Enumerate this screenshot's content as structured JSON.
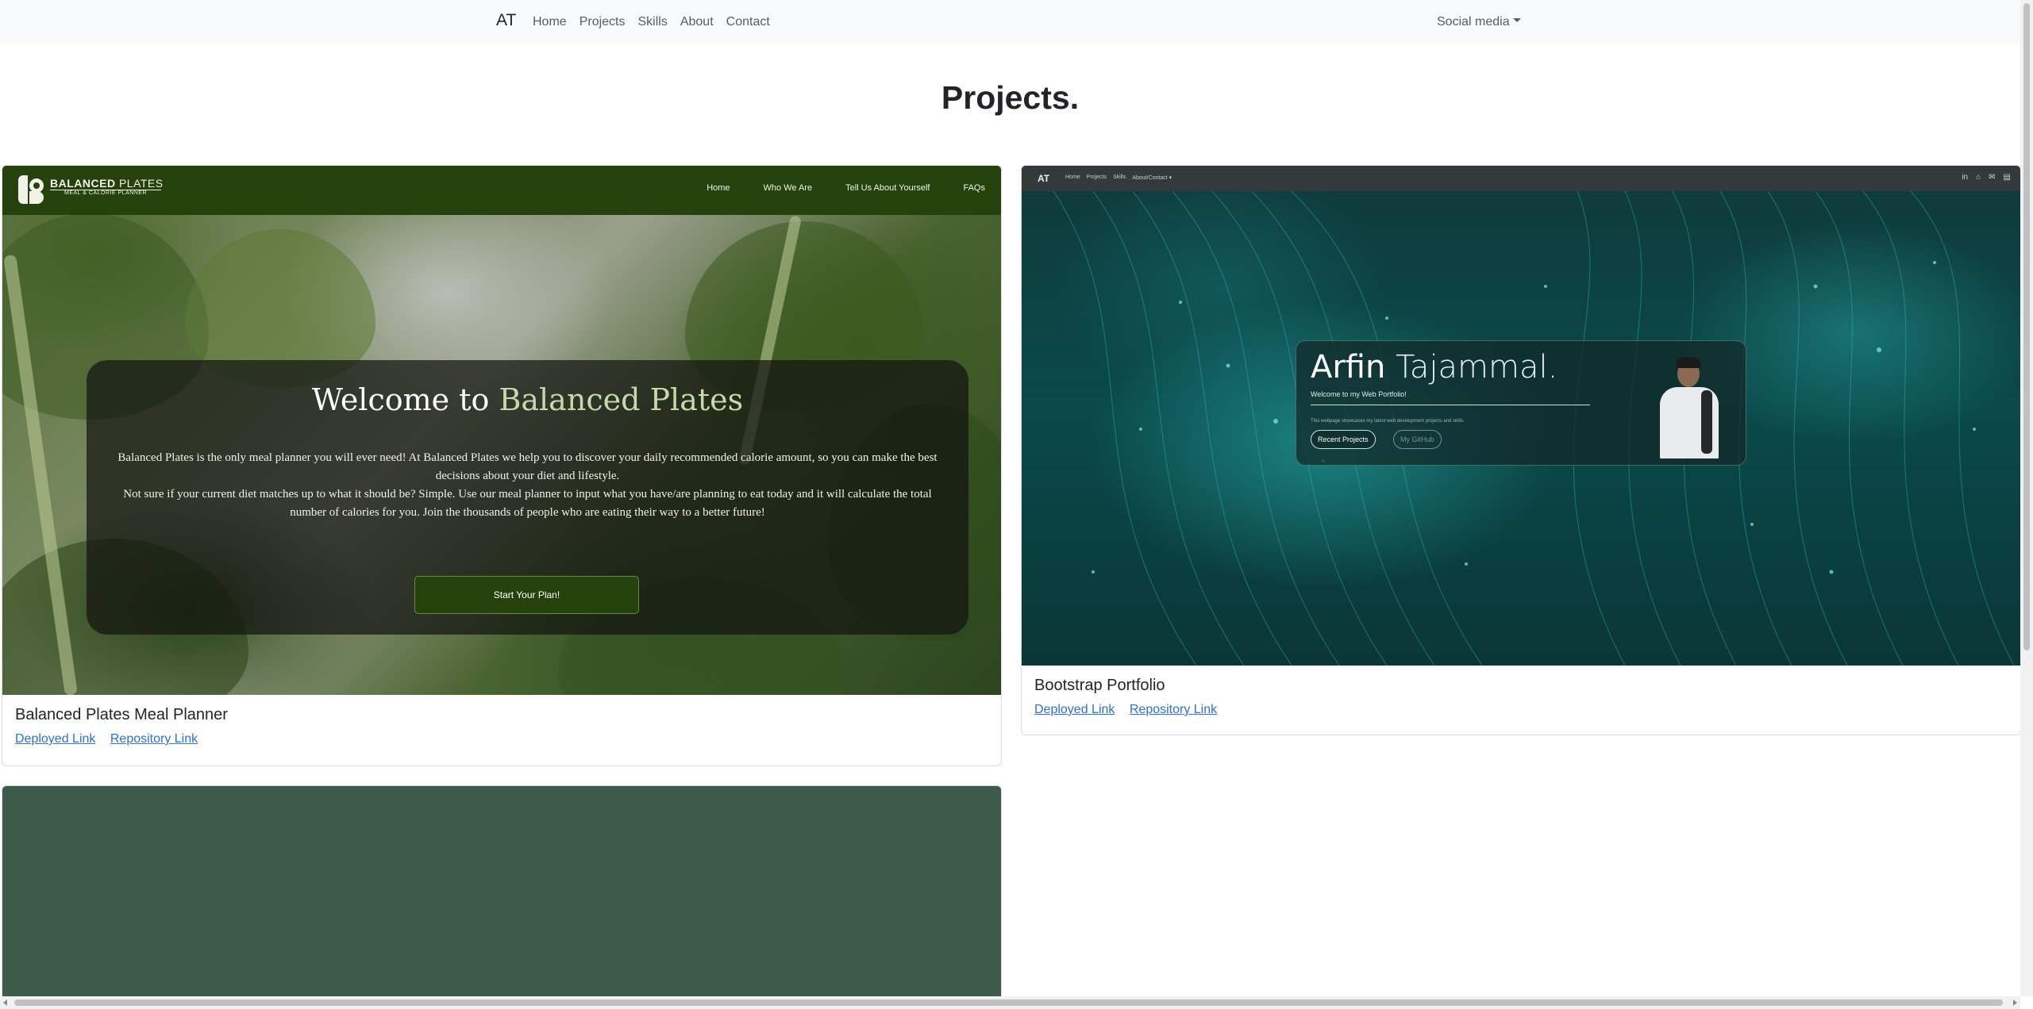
{
  "navbar": {
    "brand": "AT",
    "links": [
      "Home",
      "Projects",
      "Skills",
      "About",
      "Contact"
    ],
    "social_label": "Social media"
  },
  "page_title": "Projects.",
  "projects": [
    {
      "title": "Balanced Plates Meal Planner",
      "deployed_label": "Deployed Link",
      "repo_label": "Repository Link",
      "screenshot": {
        "logo_text_bold": "BALANCED",
        "logo_text_thin": " PLATES",
        "logo_sub": "MEAL & CALORIE PLANNER",
        "menu": [
          "Home",
          "Who We Are",
          "Tell Us About Yourself",
          "FAQs"
        ],
        "heading_plain": "Welcome to ",
        "heading_accent": "Balanced Plates",
        "paragraph_1": "Balanced Plates is the only meal planner you will ever need! At Balanced Plates we help you to discover your daily recommended calorie amount, so you can make the best decisions about your diet and lifestyle.",
        "paragraph_2": "Not sure if your current diet matches up to what it should be? Simple. Use our meal planner to input what you have/are planning to eat today and it will calculate the total number of calories for you. Join the thousands of people who are eating their way to a better future!",
        "button": "Start Your Plan!"
      }
    },
    {
      "title": "Bootstrap Portfolio",
      "deployed_label": "Deployed Link",
      "repo_label": "Repository Link",
      "screenshot": {
        "brand": "AT",
        "menu": [
          "Home",
          "Projects",
          "Skills",
          "About/Contact ▾"
        ],
        "name_first": "Arfin",
        "name_last": " Tajammal.",
        "welcome": "Welcome to my Web Portfolio!",
        "small_text": "This webpage showcases my latest web development projects and skills.",
        "button_1": "Recent Projects",
        "button_2": "My GitHub",
        "icons": [
          "in",
          "⌂",
          "✉",
          "▤"
        ]
      }
    }
  ],
  "colors": {
    "link": "#2f6fd6",
    "balanced_green": "#25420c",
    "third_card": "#3c5b4a"
  }
}
